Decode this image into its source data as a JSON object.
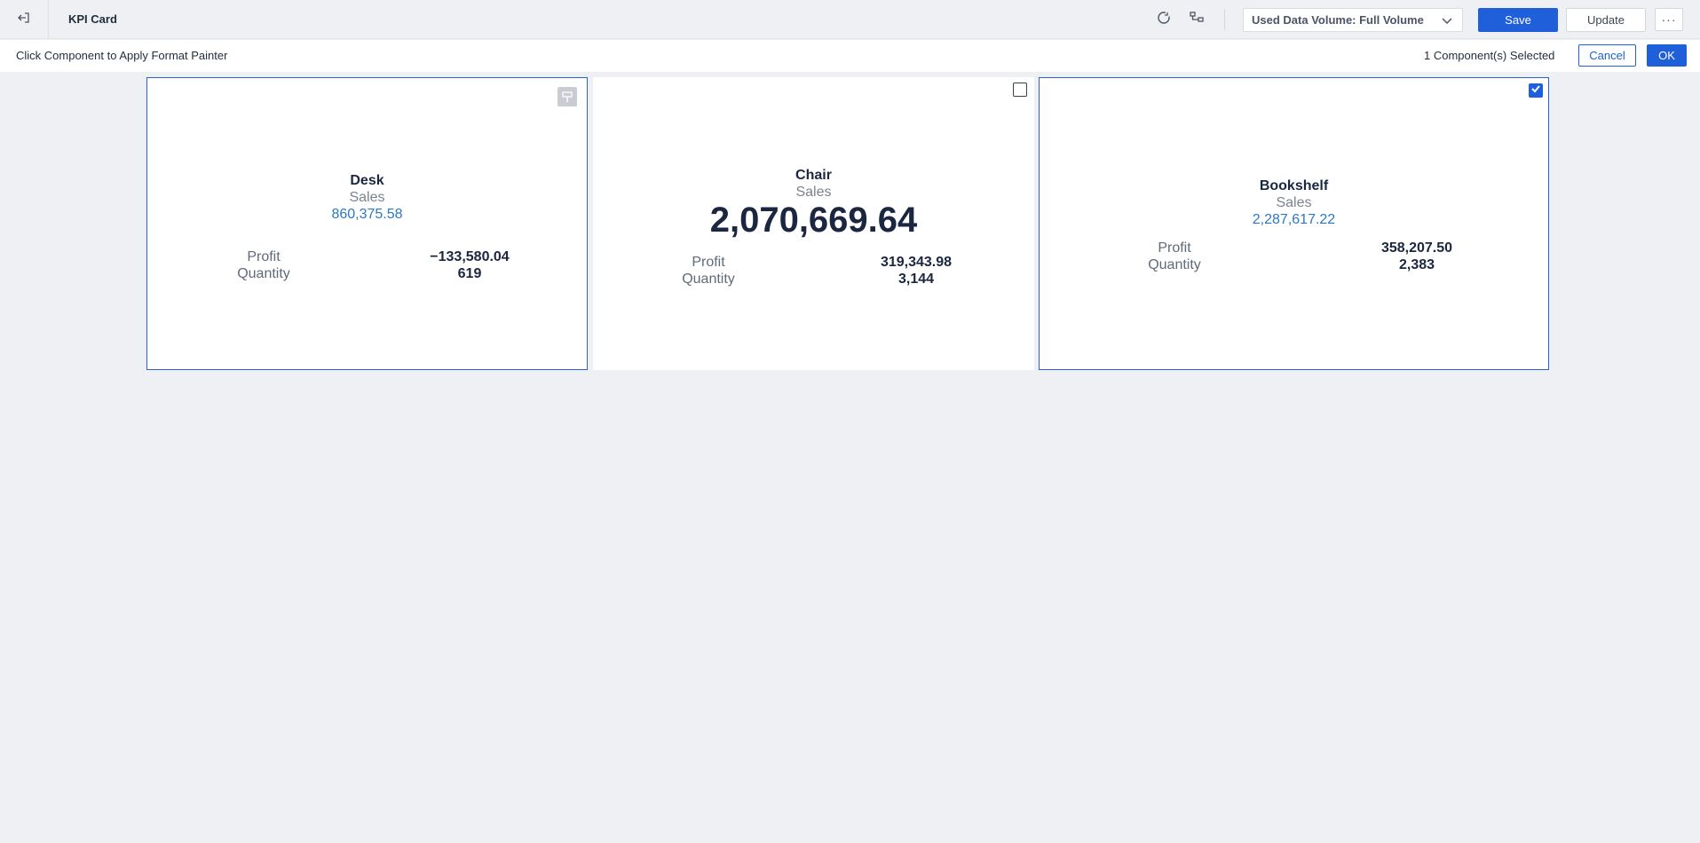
{
  "header": {
    "title": "KPI Card",
    "data_volume_label": "Used Data Volume: Full Volume",
    "save_label": "Save",
    "update_label": "Update",
    "more_label": "···"
  },
  "format_painter": {
    "instruction": "Click Component to Apply Format Painter",
    "selected_count_text": "1 Component(s) Selected",
    "cancel_label": "Cancel",
    "ok_label": "OK"
  },
  "cards": [
    {
      "title": "Desk",
      "metric_label": "Sales",
      "metric_value": "860,375.58",
      "rows": [
        {
          "label": "Profit",
          "value": "−133,580.04"
        },
        {
          "label": "Quantity",
          "value": "619"
        }
      ],
      "state": "format-source"
    },
    {
      "title": "Chair",
      "metric_label": "Sales",
      "metric_value": "2,070,669.64",
      "rows": [
        {
          "label": "Profit",
          "value": "319,343.98"
        },
        {
          "label": "Quantity",
          "value": "3,144"
        }
      ],
      "state": "unchecked"
    },
    {
      "title": "Bookshelf",
      "metric_label": "Sales",
      "metric_value": "2,287,617.22",
      "rows": [
        {
          "label": "Profit",
          "value": "358,207.50"
        },
        {
          "label": "Quantity",
          "value": "2,383"
        }
      ],
      "state": "checked"
    }
  ],
  "colors": {
    "accent": "#1f5fd9",
    "highlight_value": "#2b78c4",
    "background": "#eef0f4"
  },
  "icons": [
    "exit-icon",
    "refresh-icon",
    "data-lineage-icon",
    "chevron-down-icon",
    "format-painter-icon",
    "checkbox-icon",
    "check-icon"
  ]
}
